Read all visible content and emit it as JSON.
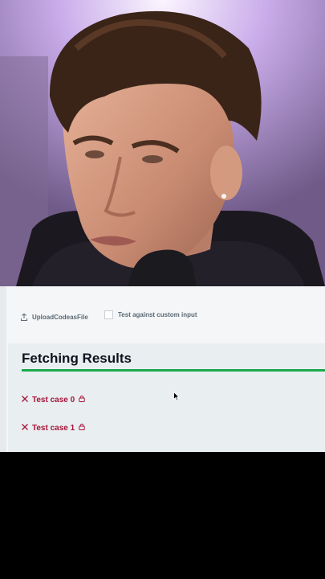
{
  "editor": {
    "upload_label": "UploadCodeasFile",
    "custom_input_label": "Test against custom input",
    "custom_input_checked": false
  },
  "results": {
    "title": "Fetching Results",
    "progress_percent": 100,
    "test_cases": [
      {
        "label": "Test case 0",
        "status": "failed",
        "locked": true
      },
      {
        "label": "Test case 1",
        "status": "failed",
        "locked": true
      }
    ]
  },
  "colors": {
    "progress": "#1ba94c",
    "failed": "#a5153a",
    "title": "#0e141e"
  },
  "icons": [
    "upload-icon",
    "close-x-icon",
    "lock-icon",
    "mouse-cursor-icon"
  ]
}
